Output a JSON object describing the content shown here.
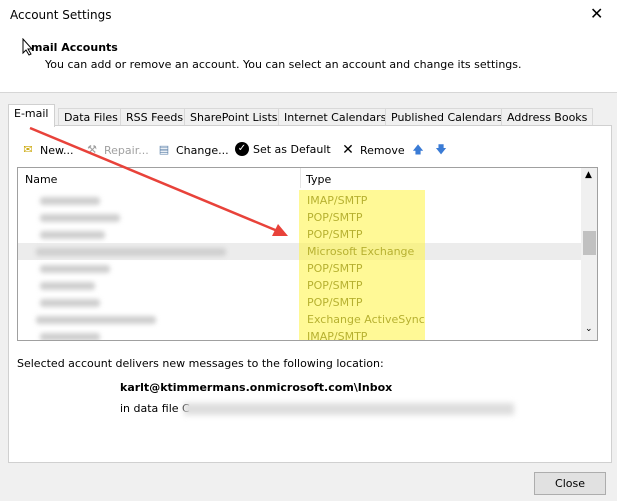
{
  "window": {
    "title": "Account Settings",
    "close_glyph": "✕"
  },
  "header": {
    "title": "mail Accounts",
    "subtitle": "You can add or remove an account. You can select an account and change its settings."
  },
  "tabs": [
    {
      "label": "E-mail",
      "active": true
    },
    {
      "label": "Data Files"
    },
    {
      "label": "RSS Feeds"
    },
    {
      "label": "SharePoint Lists"
    },
    {
      "label": "Internet Calendars"
    },
    {
      "label": "Published Calendars"
    },
    {
      "label": "Address Books"
    }
  ],
  "toolbar": {
    "new": "New...",
    "repair": "Repair...",
    "change": "Change...",
    "set_default": "Set as Default",
    "remove": "Remove"
  },
  "list": {
    "col_name": "Name",
    "col_type": "Type",
    "rows": [
      {
        "type": "IMAP/SMTP"
      },
      {
        "type": "POP/SMTP"
      },
      {
        "type": "POP/SMTP"
      },
      {
        "type": "Microsoft Exchange",
        "selected": true
      },
      {
        "type": "POP/SMTP"
      },
      {
        "type": "POP/SMTP"
      },
      {
        "type": "POP/SMTP"
      },
      {
        "type": "Exchange ActiveSync"
      },
      {
        "type": "IMAP/SMTP"
      }
    ]
  },
  "delivery": {
    "label": "Selected account delivers new messages to the following location:",
    "location": "karlt@ktimmermans.onmicrosoft.com\\Inbox",
    "data_file_prefix": "in data file C"
  },
  "footer": {
    "close": "Close"
  },
  "colors": {
    "highlight": "#fff580",
    "arrow": "#e8423a",
    "up_down_arrows": "#3a7bd5"
  }
}
